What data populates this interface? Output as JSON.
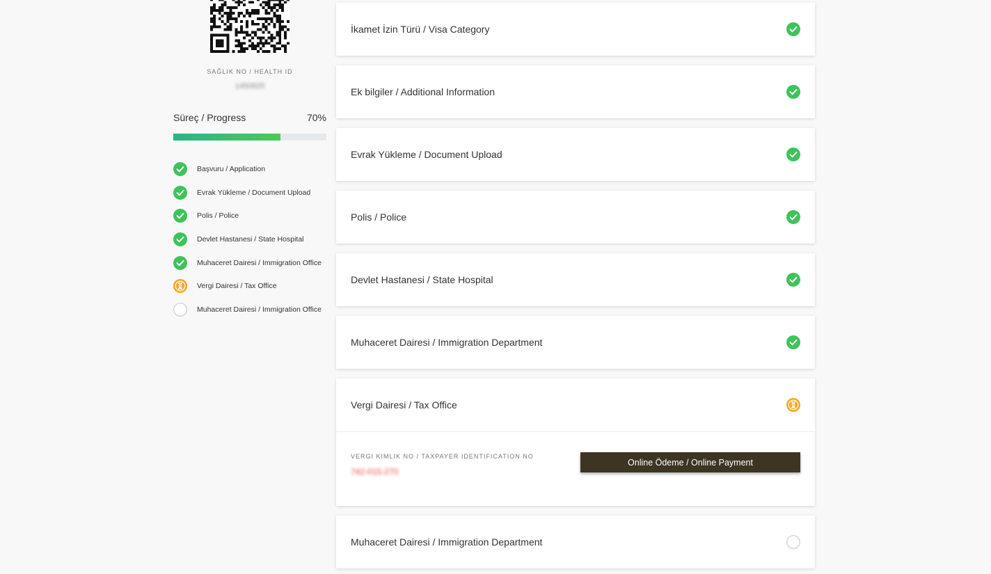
{
  "sidebar": {
    "health_label": "SAĞLIK NO / HEALTH ID",
    "health_value": "1450825",
    "progress_label": "Süreç / Progress",
    "progress_text": "70%",
    "progress_fraction": 0.7,
    "steps": [
      {
        "label": "Başvuru / Application",
        "status": "done",
        "icon": "check-circle-icon"
      },
      {
        "label": "Evrak Yükleme / Document Upload",
        "status": "done",
        "icon": "check-circle-icon"
      },
      {
        "label": "Polis / Police",
        "status": "done",
        "icon": "check-circle-icon"
      },
      {
        "label": "Devlet Hastanesi / State Hospital",
        "status": "done",
        "icon": "check-circle-icon"
      },
      {
        "label": "Muhaceret Dairesi / Immigration Office",
        "status": "done",
        "icon": "check-circle-icon"
      },
      {
        "label": "Vergi Dairesi / Tax Office",
        "status": "pending",
        "icon": "hourglass-icon"
      },
      {
        "label": "Muhaceret Dairesi / Immigration Office",
        "status": "todo",
        "icon": "empty-circle-icon"
      }
    ]
  },
  "cards": [
    {
      "title": "İkamet İzin Türü / Visa Category",
      "status": "done"
    },
    {
      "title": "Ek bilgiler / Additional Information",
      "status": "done"
    },
    {
      "title": "Evrak Yükleme / Document Upload",
      "status": "done"
    },
    {
      "title": "Polis / Police",
      "status": "done"
    },
    {
      "title": "Devlet Hastanesi / State Hospital",
      "status": "done"
    },
    {
      "title": "Muhaceret Dairesi / Immigration Department",
      "status": "done"
    },
    {
      "title": "Vergi Dairesi / Tax Office",
      "status": "pending"
    },
    {
      "title": "Muhaceret Dairesi / Immigration Department",
      "status": "todo"
    }
  ],
  "tax": {
    "label": "VERGI KIMLIK NO / TAXPAYER IDENTIFICATION NO",
    "value": "742-015-270",
    "pay_button": "Online Ödeme / Online Payment"
  },
  "colors": {
    "done": "#3ec35b",
    "pending": "#f5a623",
    "todo_border": "#cccccc",
    "button": "#3d3423",
    "tax_value": "#e8453c"
  }
}
